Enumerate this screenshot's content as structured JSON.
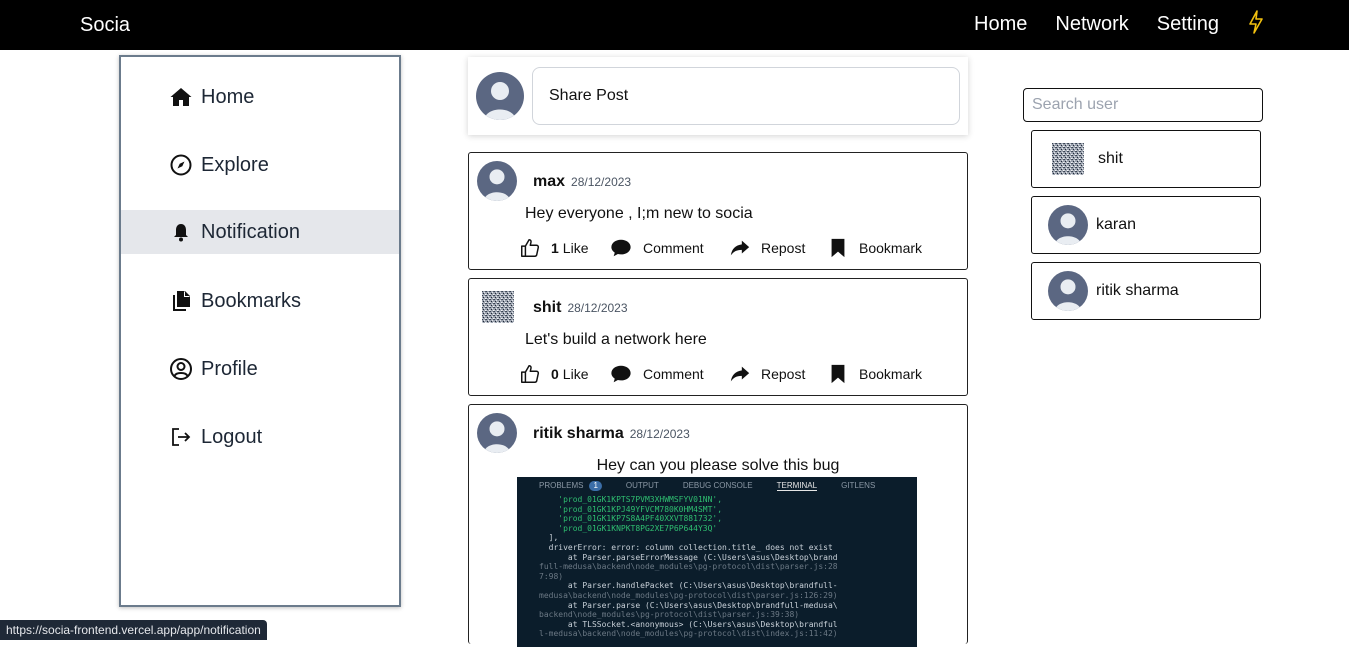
{
  "header": {
    "brand": "Socia",
    "nav": [
      "Home",
      "Network",
      "Setting"
    ],
    "bolt_icon": "lightning-icon"
  },
  "sidebar": {
    "items": [
      {
        "label": "Home",
        "icon": "home-icon"
      },
      {
        "label": "Explore",
        "icon": "compass-icon"
      },
      {
        "label": "Notification",
        "icon": "bell-icon",
        "active": true
      },
      {
        "label": "Bookmarks",
        "icon": "copy-icon"
      },
      {
        "label": "Profile",
        "icon": "user-circle-icon"
      },
      {
        "label": "Logout",
        "icon": "logout-icon"
      }
    ]
  },
  "composer": {
    "placeholder": "Share Post"
  },
  "actions": {
    "like": "Like",
    "comment": "Comment",
    "repost": "Repost",
    "bookmark": "Bookmark"
  },
  "posts": [
    {
      "author": "max",
      "date": "28/12/2023",
      "text": "Hey everyone , I;m new to socia",
      "likes": "1"
    },
    {
      "author": "shit",
      "date": "28/12/2023",
      "text": "Let's build a network here",
      "likes": "0"
    },
    {
      "author": "ritik sharma",
      "date": "28/12/2023",
      "text": "Hey can you please solve this bug"
    }
  ],
  "terminal": {
    "tabs": [
      "PROBLEMS",
      "1",
      "OUTPUT",
      "DEBUG CONSOLE",
      "TERMINAL",
      "GITLENS"
    ],
    "lines": [
      "    'prod_01GK1KPTS7PVM3XHWMSFYV01NN',",
      "    'prod_01GK1KPJ49YFVCM780K0HM4SMT',",
      "    'prod_01GK1KP7S8A4PF40XXVT881732',",
      "    'prod_01GK1KNPKT8PG2XE7P6P644Y3Q'",
      "  ],",
      "  driverError: error: column collection.title_ does not exist",
      "      at Parser.parseErrorMessage (C:\\Users\\asus\\Desktop\\brand",
      "full-medusa\\backend\\node_modules\\pg-protocol\\dist\\parser.js:28",
      "7:98)",
      "      at Parser.handlePacket (C:\\Users\\asus\\Desktop\\brandfull-",
      "medusa\\backend\\node_modules\\pg-protocol\\dist\\parser.js:126:29)",
      "      at Parser.parse (C:\\Users\\asus\\Desktop\\brandfull-medusa\\",
      "backend\\node_modules\\pg-protocol\\dist\\parser.js:39:38)",
      "      at TLSSocket.<anonymous> (C:\\Users\\asus\\Desktop\\brandful",
      "l-medusa\\backend\\node_modules\\pg-protocol\\dist\\index.js:11:42)"
    ]
  },
  "search": {
    "placeholder": "Search user"
  },
  "users": [
    {
      "name": "shit",
      "avatar": "pixelated-avatar"
    },
    {
      "name": "karan",
      "avatar": "default-avatar"
    },
    {
      "name": "ritik sharma",
      "avatar": "default-avatar"
    }
  ],
  "status_url": "https://socia-frontend.vercel.app/app/notification",
  "colors": {
    "topbar": "#000000",
    "bolt": "#f2c10f",
    "active_nav": "#e5e7eb",
    "avatar": "#5b6782"
  }
}
